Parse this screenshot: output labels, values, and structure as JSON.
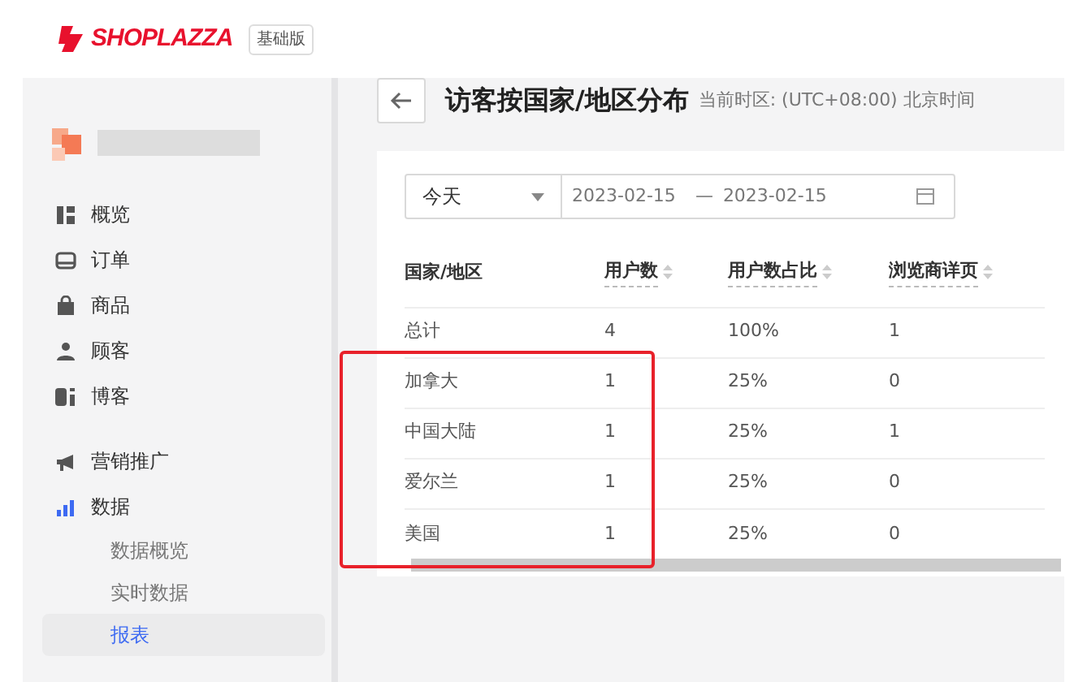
{
  "header": {
    "logo": "SHOPLAZZA",
    "plan_badge": "基础版"
  },
  "sidebar": {
    "items": [
      {
        "label": "概览",
        "selected": false
      },
      {
        "label": "订单",
        "selected": false
      },
      {
        "label": "商品",
        "selected": false
      },
      {
        "label": "顾客",
        "selected": false
      },
      {
        "label": "博客",
        "selected": false
      },
      {
        "label": "营销推广",
        "selected": false
      },
      {
        "label": "数据",
        "selected": true,
        "children": [
          {
            "label": "数据概览",
            "selected": false
          },
          {
            "label": "实时数据",
            "selected": false
          },
          {
            "label": "报表",
            "selected": true
          }
        ]
      }
    ]
  },
  "page": {
    "title": "访客按国家/地区分布",
    "timezone": "当前时区: (UTC+08:00) 北京时间"
  },
  "filter": {
    "range": "今天",
    "start_date": "2023-02-15",
    "separator": "—",
    "end_date": "2023-02-15"
  },
  "table": {
    "columns": [
      {
        "label": "国家/地区",
        "sortable": false
      },
      {
        "label": "用户数",
        "sortable": true
      },
      {
        "label": "用户数占比",
        "sortable": true
      },
      {
        "label": "浏览商详页",
        "sortable": true
      }
    ],
    "rows": [
      [
        "总计",
        "4",
        "100%",
        "1"
      ],
      [
        "加拿大",
        "1",
        "25%",
        "0"
      ],
      [
        "中国大陆",
        "1",
        "25%",
        "1"
      ],
      [
        "爱尔兰",
        "1",
        "25%",
        "0"
      ],
      [
        "美国",
        "1",
        "25%",
        "0"
      ]
    ]
  }
}
